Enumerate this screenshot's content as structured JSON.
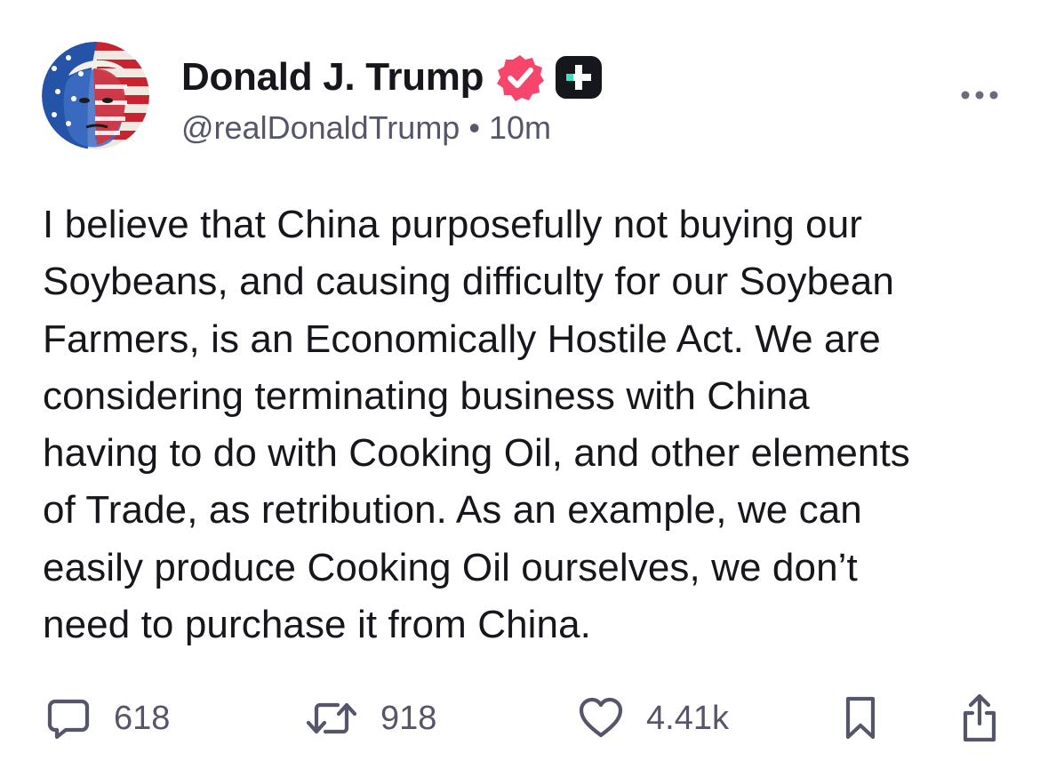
{
  "post": {
    "author": {
      "display_name": "Donald J. Trump",
      "handle": "@realDonaldTrump",
      "separator": "•",
      "time_ago": "10m",
      "verified": true
    },
    "text_lines": [
      "I believe that China purposefully not buying our",
      "Soybeans, and causing difficulty for our Soybean",
      "Farmers, is an Economically Hostile Act. We are",
      "considering terminating business with China",
      "having to do with Cooking Oil, and other elements",
      "of Trade, as retribution. As an example, we can",
      "easily produce Cooking Oil ourselves, we don’t",
      "need to purchase it from China."
    ],
    "actions": {
      "replies": "618",
      "reposts": "918",
      "likes": "4.41k"
    }
  },
  "icons": {
    "verified": "verified-badge-icon",
    "plus": "plus-badge-icon",
    "more": "more-horizontal-icon",
    "reply": "comment-icon",
    "repost": "repost-icon",
    "like": "heart-icon",
    "bookmark": "bookmark-icon",
    "share": "share-icon"
  },
  "colors": {
    "text": "#16161d",
    "muted": "#56566a",
    "verified_badge": "#f6466b",
    "plus_badge": "#16161d",
    "plus_accent": "#3ee0c0"
  }
}
